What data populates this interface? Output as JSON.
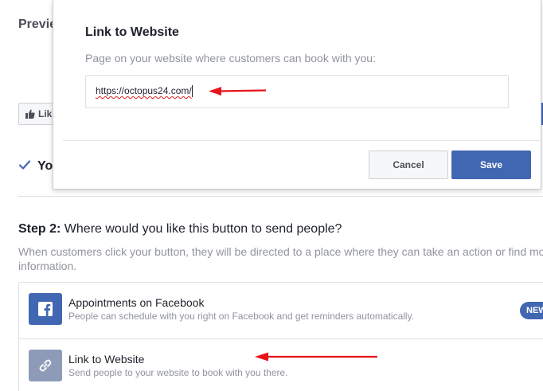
{
  "background": {
    "preview_title": "Previe",
    "like_button_label": "Lik",
    "step1_text": "Yo",
    "step2": {
      "heading_bold": "Step 2:",
      "heading_rest": " Where would you like this button to send people?",
      "description": "When customers click your button, they will be directed to a place where they can take an action or find more information."
    },
    "options": [
      {
        "title": "Appointments on Facebook",
        "subtitle": "People can schedule with you right on Facebook and get reminders automatically.",
        "badge": "NEW",
        "icon": "facebook-icon"
      },
      {
        "title": "Link to Website",
        "subtitle": "Send people to your website to book with you there.",
        "icon": "link-icon"
      }
    ]
  },
  "modal": {
    "title": "Link to Website",
    "label": "Page on your website where customers can book with you:",
    "url_value": "https://octopus24.com/",
    "cancel_label": "Cancel",
    "save_label": "Save"
  },
  "colors": {
    "accent": "#4267b2",
    "annotation_arrow": "#e8141b",
    "muted_text": "#90949c"
  }
}
